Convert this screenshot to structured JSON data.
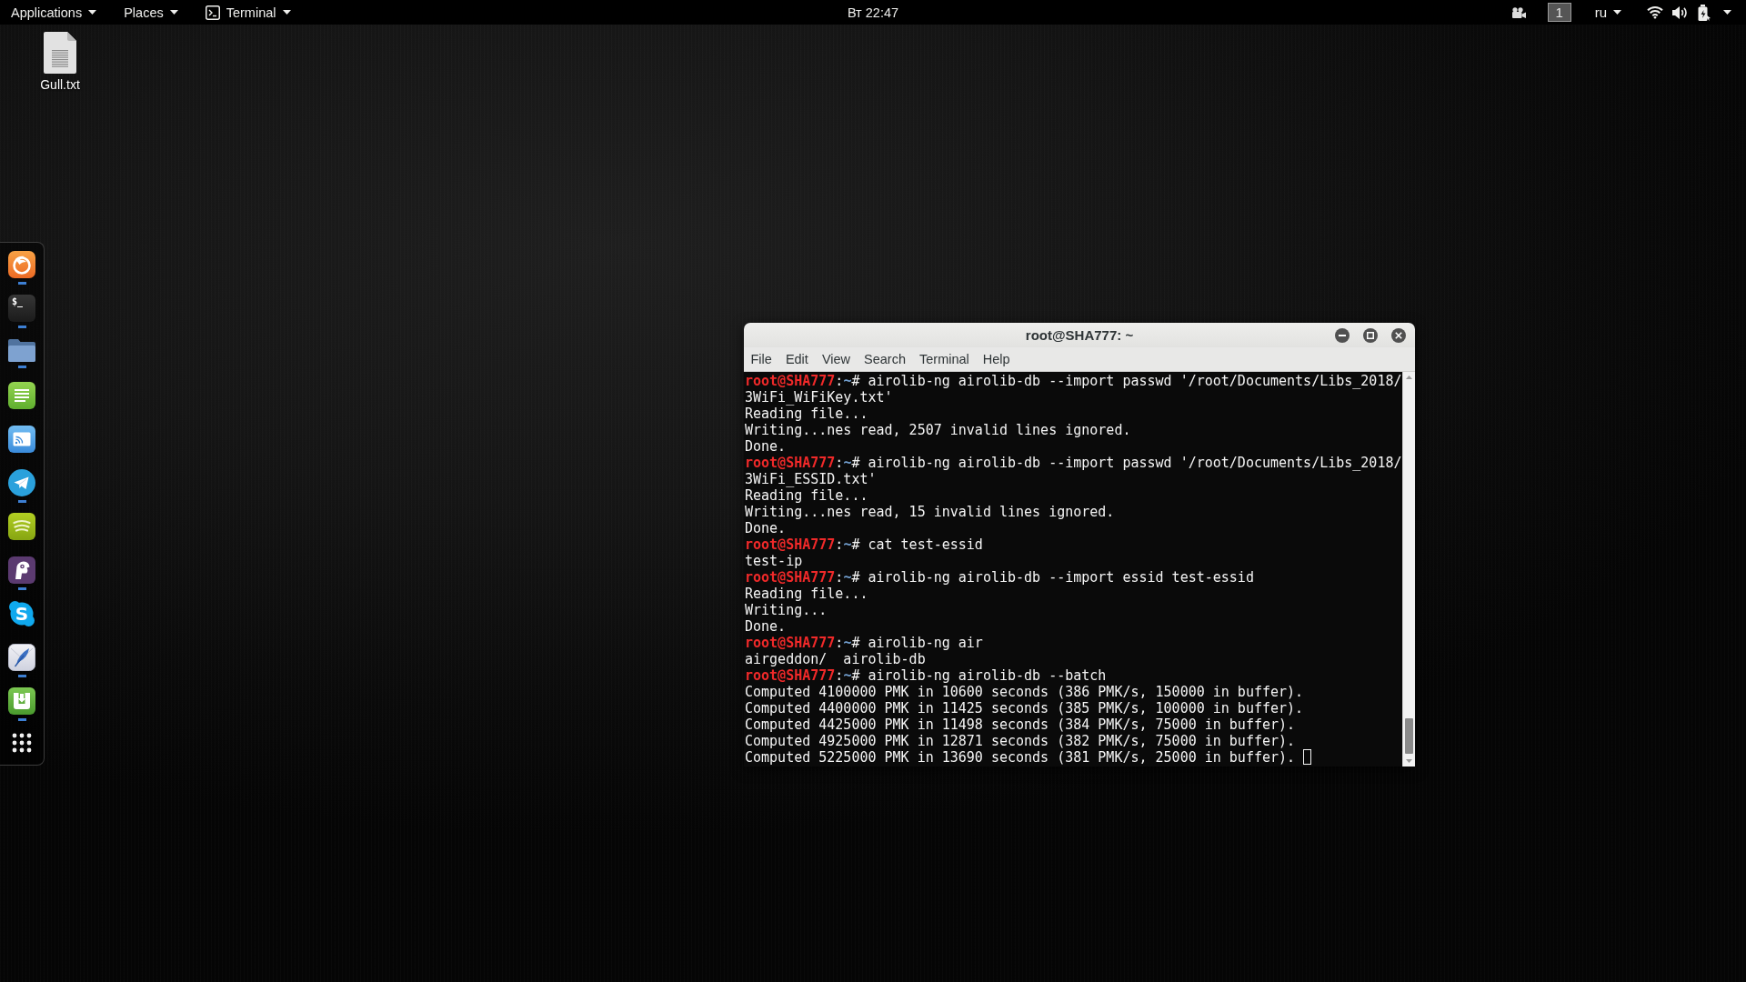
{
  "top_bar": {
    "menus": [
      {
        "kind": "menu",
        "label": "Applications"
      },
      {
        "kind": "menu",
        "label": "Places"
      },
      {
        "kind": "app",
        "label": "Terminal"
      }
    ],
    "clock": "Вт 22:47",
    "workspace": "1",
    "keyboard_layout": "ru"
  },
  "desktop_icons": [
    {
      "label": "Gull.txt"
    }
  ],
  "dock": {
    "items": [
      {
        "kind": "ring",
        "running": true
      },
      {
        "kind": "terminal",
        "glyph": "$_",
        "running": true
      },
      {
        "kind": "folder",
        "running": true
      },
      {
        "kind": "notes",
        "running": false
      },
      {
        "kind": "cast",
        "running": false
      },
      {
        "kind": "plane",
        "running": true
      },
      {
        "kind": "waves",
        "running": false
      },
      {
        "kind": "bird",
        "running": true
      },
      {
        "kind": "cloud",
        "glyph": "S",
        "running": false
      },
      {
        "kind": "feather",
        "running": true
      },
      {
        "kind": "download",
        "running": true
      }
    ]
  },
  "terminal_window": {
    "title": "root@SHA777: ~",
    "menu": [
      "File",
      "Edit",
      "View",
      "Search",
      "Terminal",
      "Help"
    ],
    "lines": [
      {
        "kind": "prompt",
        "user": "root@SHA777",
        "colon": ":",
        "path": "~",
        "sign": "#",
        "command": "airolib-ng airolib-db --import passwd '/root/Documents/Libs_2018/3WiFi_WiFiKey.txt'"
      },
      {
        "kind": "output",
        "text": "Reading file..."
      },
      {
        "kind": "output",
        "text": "Writing...nes read, 2507 invalid lines ignored."
      },
      {
        "kind": "output",
        "text": "Done."
      },
      {
        "kind": "prompt",
        "user": "root@SHA777",
        "colon": ":",
        "path": "~",
        "sign": "#",
        "command": "airolib-ng airolib-db --import passwd '/root/Documents/Libs_2018/3WiFi_ESSID.txt'"
      },
      {
        "kind": "output",
        "text": "Reading file..."
      },
      {
        "kind": "output",
        "text": "Writing...nes read, 15 invalid lines ignored."
      },
      {
        "kind": "output",
        "text": "Done."
      },
      {
        "kind": "prompt",
        "user": "root@SHA777",
        "colon": ":",
        "path": "~",
        "sign": "#",
        "command": "cat test-essid"
      },
      {
        "kind": "output",
        "text": "test-ip"
      },
      {
        "kind": "prompt",
        "user": "root@SHA777",
        "colon": ":",
        "path": "~",
        "sign": "#",
        "command": "airolib-ng airolib-db --import essid test-essid"
      },
      {
        "kind": "output",
        "text": "Reading file..."
      },
      {
        "kind": "output",
        "text": "Writing..."
      },
      {
        "kind": "output",
        "text": "Done."
      },
      {
        "kind": "prompt",
        "user": "root@SHA777",
        "colon": ":",
        "path": "~",
        "sign": "#",
        "command": "airolib-ng air"
      },
      {
        "kind": "output",
        "text": "airgeddon/  airolib-db"
      },
      {
        "kind": "prompt",
        "user": "root@SHA777",
        "colon": ":",
        "path": "~",
        "sign": "#",
        "command": "airolib-ng airolib-db --batch"
      },
      {
        "kind": "output",
        "text": "Computed 4100000 PMK in 10600 seconds (386 PMK/s, 150000 in buffer)."
      },
      {
        "kind": "output",
        "text": "Computed 4400000 PMK in 11425 seconds (385 PMK/s, 100000 in buffer)."
      },
      {
        "kind": "output",
        "text": "Computed 4425000 PMK in 11498 seconds (384 PMK/s, 75000 in buffer)."
      },
      {
        "kind": "output",
        "text": "Computed 4925000 PMK in 12871 seconds (382 PMK/s, 75000 in buffer)."
      },
      {
        "kind": "output",
        "text": "Computed 5225000 PMK in 13690 seconds (381 PMK/s, 25000 in buffer)."
      }
    ]
  }
}
